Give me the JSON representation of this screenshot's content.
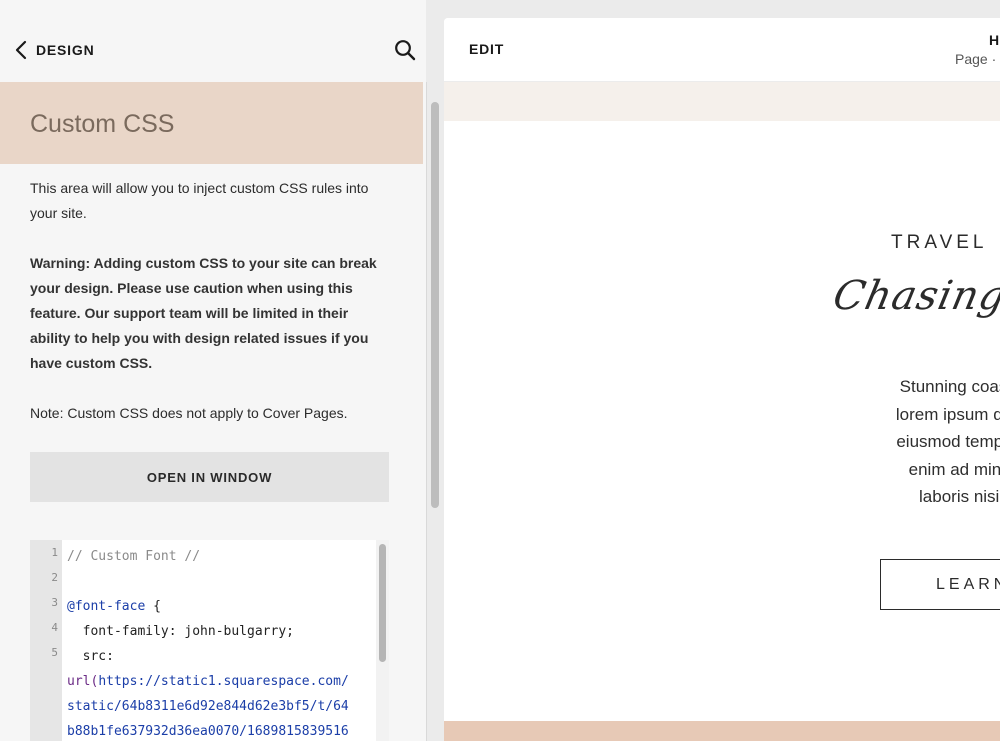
{
  "left_panel": {
    "back_label": "DESIGN",
    "title": "Custom CSS",
    "description_1": "This area will allow you to inject custom CSS rules into your site.",
    "warning": "Warning: Adding custom CSS to your site can break your design. Please use caution when using this feature. Our support team will be limited in their ability to help you with design related issues if you have custom CSS.",
    "note": "Note: Custom CSS does not apply to Cover Pages.",
    "open_window_label": "OPEN IN WINDOW",
    "code_editor": {
      "line_numbers": [
        "1",
        "2",
        "3",
        "4",
        "5"
      ],
      "lines": [
        "// Custom Font //",
        "",
        "@font-face {",
        "  font-family: john-bulgarry;",
        "  src:",
        "url(https://static1.squarespace.com/",
        "static/64b8311e6d92e844d62e3bf5/t/64",
        "b88b1fe637932d36ea0070/1689815839516"
      ]
    }
  },
  "preview": {
    "edit_label": "EDIT",
    "page_name": "H",
    "page_meta": "Page · I",
    "travel_heading": "TRAVEL",
    "script_title": "Chasing",
    "body_lines": [
      "Stunning coastlines, all day su",
      "lorem ipsum dolor sit amet, con",
      "eiusmod tempor incididunt ut la",
      "enim ad minim veniam, quis",
      "laboris nisi ut aliquip ex e"
    ],
    "button_label": "LEARN"
  },
  "colors": {
    "header_band": "#e9d6c8",
    "title_text": "#7a6a5d",
    "announce_bar": "#f5f0eb",
    "footer_band": "#e7c9b6",
    "code_keyword": "#1b3ea8",
    "code_url_fn": "#6b2b86"
  },
  "icons": {
    "back": "chevron-left-icon",
    "search": "search-icon"
  }
}
